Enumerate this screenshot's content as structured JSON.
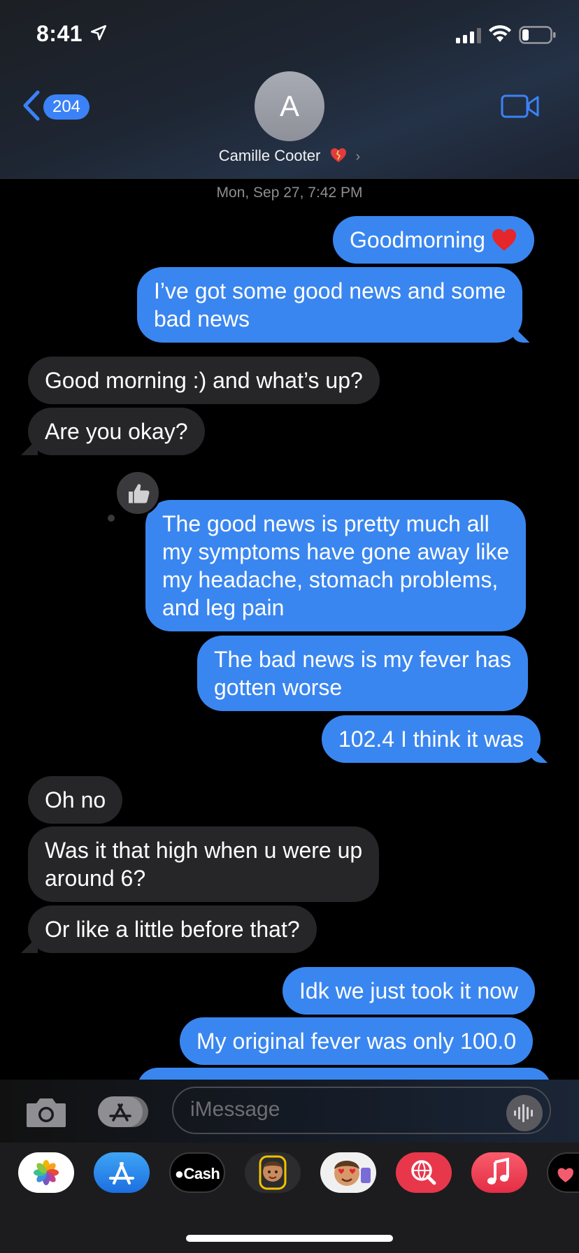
{
  "status_bar": {
    "time": "8:41"
  },
  "nav": {
    "back_count": "204",
    "contact_initial": "A",
    "contact_name": "Camille Cooter"
  },
  "conversation": {
    "timestamp": "Mon, Sep 27, 7:42 PM",
    "messages": [
      {
        "from": "me",
        "text": "Goodmorning"
      },
      {
        "from": "me",
        "lines": [
          "I’ve got some good news and some",
          "bad news"
        ]
      },
      {
        "from": "them",
        "text": "Good morning :) and what’s up?"
      },
      {
        "from": "them",
        "text": "Are you okay?"
      },
      {
        "from": "me",
        "lines": [
          "The good news is pretty much all",
          "my symptoms have gone away like",
          "my headache, stomach problems,",
          "and leg pain"
        ],
        "reaction": "thumbs-up"
      },
      {
        "from": "me",
        "lines": [
          "The bad news is my fever has",
          "gotten worse"
        ]
      },
      {
        "from": "me",
        "text": "102.4 I think it was"
      },
      {
        "from": "them",
        "text": "Oh no"
      },
      {
        "from": "them",
        "lines": [
          "Was it that high when u were up",
          "around 6?"
        ]
      },
      {
        "from": "them",
        "text": "Or like a little before that?"
      },
      {
        "from": "me",
        "text": "Idk we just took it now"
      },
      {
        "from": "me",
        "text": "My original fever was only 100.0"
      }
    ]
  },
  "composer": {
    "placeholder": "iMessage"
  },
  "app_drawer": {
    "cash_label": "Cash"
  },
  "colors": {
    "sent": "#3a86f0",
    "received": "#262629",
    "accent": "#3b82f6"
  }
}
